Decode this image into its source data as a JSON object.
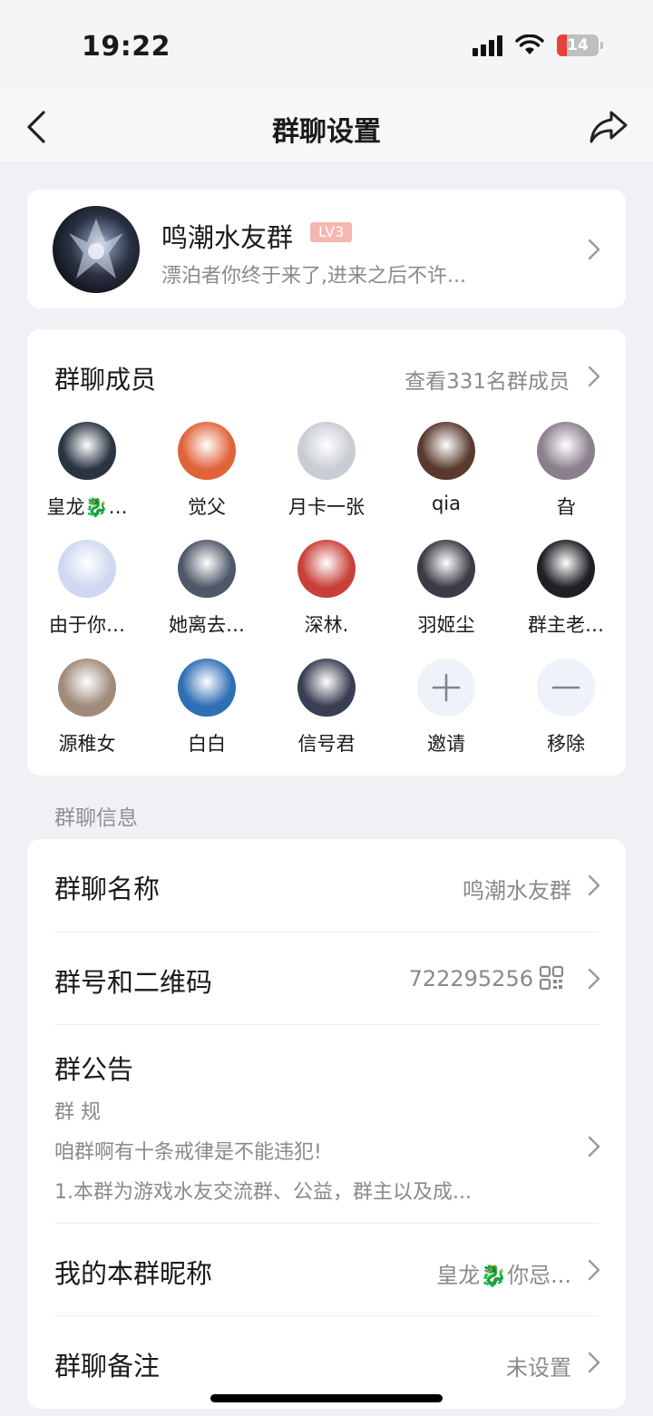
{
  "status_bar": {
    "time": "19:22",
    "battery": "14"
  },
  "nav": {
    "title": "群聊设置"
  },
  "group": {
    "name": "鸣潮水友群",
    "level": "LV3",
    "description": "漂泊者你终于来了,进来之后不许..."
  },
  "members": {
    "title": "群聊成员",
    "view_all": "查看331名群成员",
    "list": [
      {
        "name": "皇龙🐉…",
        "color": "#2b3442"
      },
      {
        "name": "觉父",
        "color": "#e0633a"
      },
      {
        "name": "月卡一张",
        "color": "#c9ccd3"
      },
      {
        "name": "qia",
        "color": "#5a3a2e"
      },
      {
        "name": "旮",
        "color": "#8a7f8c"
      },
      {
        "name": "由于你…",
        "color": "#cfd8f0"
      },
      {
        "name": "她离去…",
        "color": "#4f5868"
      },
      {
        "name": "深林.",
        "color": "#c9403a"
      },
      {
        "name": "羽姬尘",
        "color": "#3c3a44"
      },
      {
        "name": "群主老…",
        "color": "#1f1f24"
      },
      {
        "name": "源稚女",
        "color": "#a08a7a"
      },
      {
        "name": "白白",
        "color": "#2e6fb5"
      },
      {
        "name": "信号君",
        "color": "#3a3e52"
      }
    ],
    "invite_label": "邀请",
    "remove_label": "移除"
  },
  "info_section_label": "群聊信息",
  "info": {
    "name_label": "群聊名称",
    "name_value": "鸣潮水友群",
    "number_label": "群号和二维码",
    "number_value": "722295256",
    "notice_label": "群公告",
    "notice_line1": "群 规",
    "notice_line2": "咱群啊有十条戒律是不能违犯!",
    "notice_line3": "1.本群为游戏水友交流群、公益，群主以及成...",
    "nickname_label": "我的本群昵称",
    "nickname_value": "皇龙🐉你忌...",
    "remark_label": "群聊备注",
    "remark_value": "未设置"
  }
}
